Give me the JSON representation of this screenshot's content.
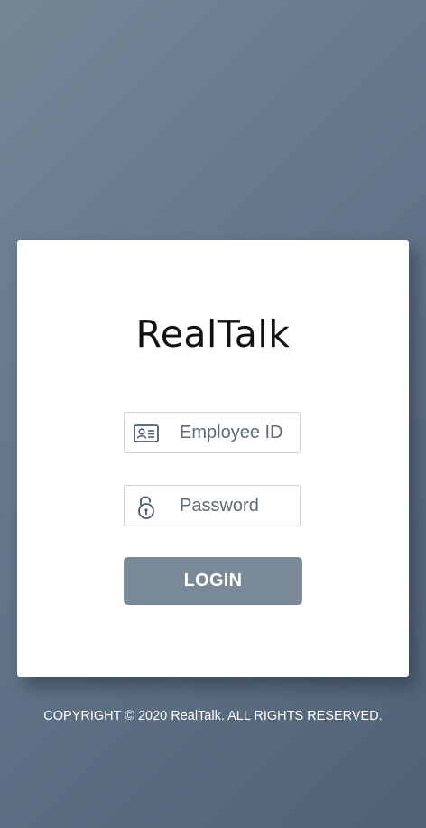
{
  "app": {
    "title": "RealTalk"
  },
  "login_form": {
    "employee_id": {
      "placeholder": "Employee ID",
      "value": "",
      "icon": "id-card-icon"
    },
    "password": {
      "placeholder": "Password",
      "value": "",
      "icon": "unlock-icon"
    },
    "login_label": "LOGIN"
  },
  "footer": {
    "copyright": "COPYRIGHT © 2020 RealTalk. ALL RIGHTS RESERVED."
  },
  "colors": {
    "background_gradient_start": "#758696",
    "background_gradient_end": "#4f6175",
    "card": "#ffffff",
    "button": "#7a8998",
    "icon": "#4d5d6d"
  }
}
